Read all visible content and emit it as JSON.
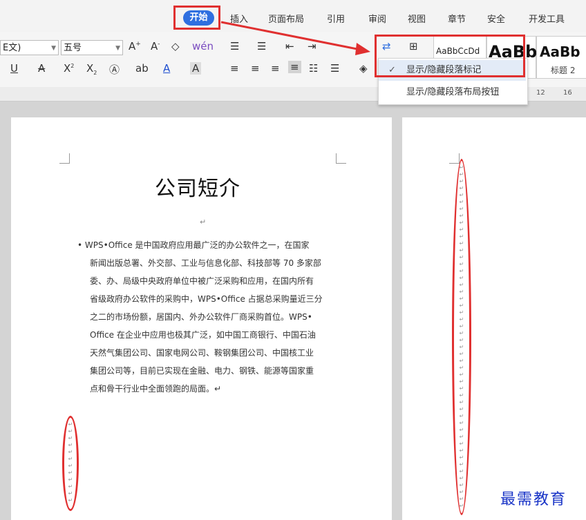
{
  "ribbon": {
    "active_tab": "开始",
    "tabs": [
      "插入",
      "页面布局",
      "引用",
      "审阅",
      "视图",
      "章节",
      "安全",
      "开发工具"
    ]
  },
  "toolbar": {
    "font_name": "E文)",
    "font_size": "五号",
    "style_sample_1": "AaBbCcDd",
    "style_sample_2": "AaBb",
    "style_sample_3": "AaBb",
    "style_caption": "标题 2"
  },
  "menu": {
    "items": [
      {
        "label": "显示/隐藏段落标记",
        "checked": true
      },
      {
        "label": "显示/隐藏段落布局按钮",
        "checked": false
      }
    ],
    "check_glyph": "✓"
  },
  "ruler": {
    "ticks": [
      "12",
      "16"
    ]
  },
  "document": {
    "title": "公司短介",
    "paragraph_mark": "↵",
    "lines": [
      "• WPS•Office 是中国政府应用最广泛的办公软件之一，在国家",
      "新闻出版总署、外交部、工业与信息化部、科技部等 70 多家部",
      "委、办、局级中央政府单位中被广泛采购和应用，在国内所有",
      "省级政府办公软件的采购中，WPS•Office 占据总采购量近三分",
      "之二的市场份额，居国内、外办公软件厂商采购首位。WPS•",
      "Office 在企业中应用也极其广泛，如中国工商银行、中国石油",
      "天然气集团公司、国家电网公司、鞍钢集团公司、中国核工业",
      "集团公司等，目前已实现在金融、电力、钢铁、能源等国家重",
      "点和骨干行业中全面领跑的局面。↵"
    ]
  },
  "watermark": "最需教育",
  "accent_color": "#e03030",
  "active_tab_color": "#2f6fe0"
}
